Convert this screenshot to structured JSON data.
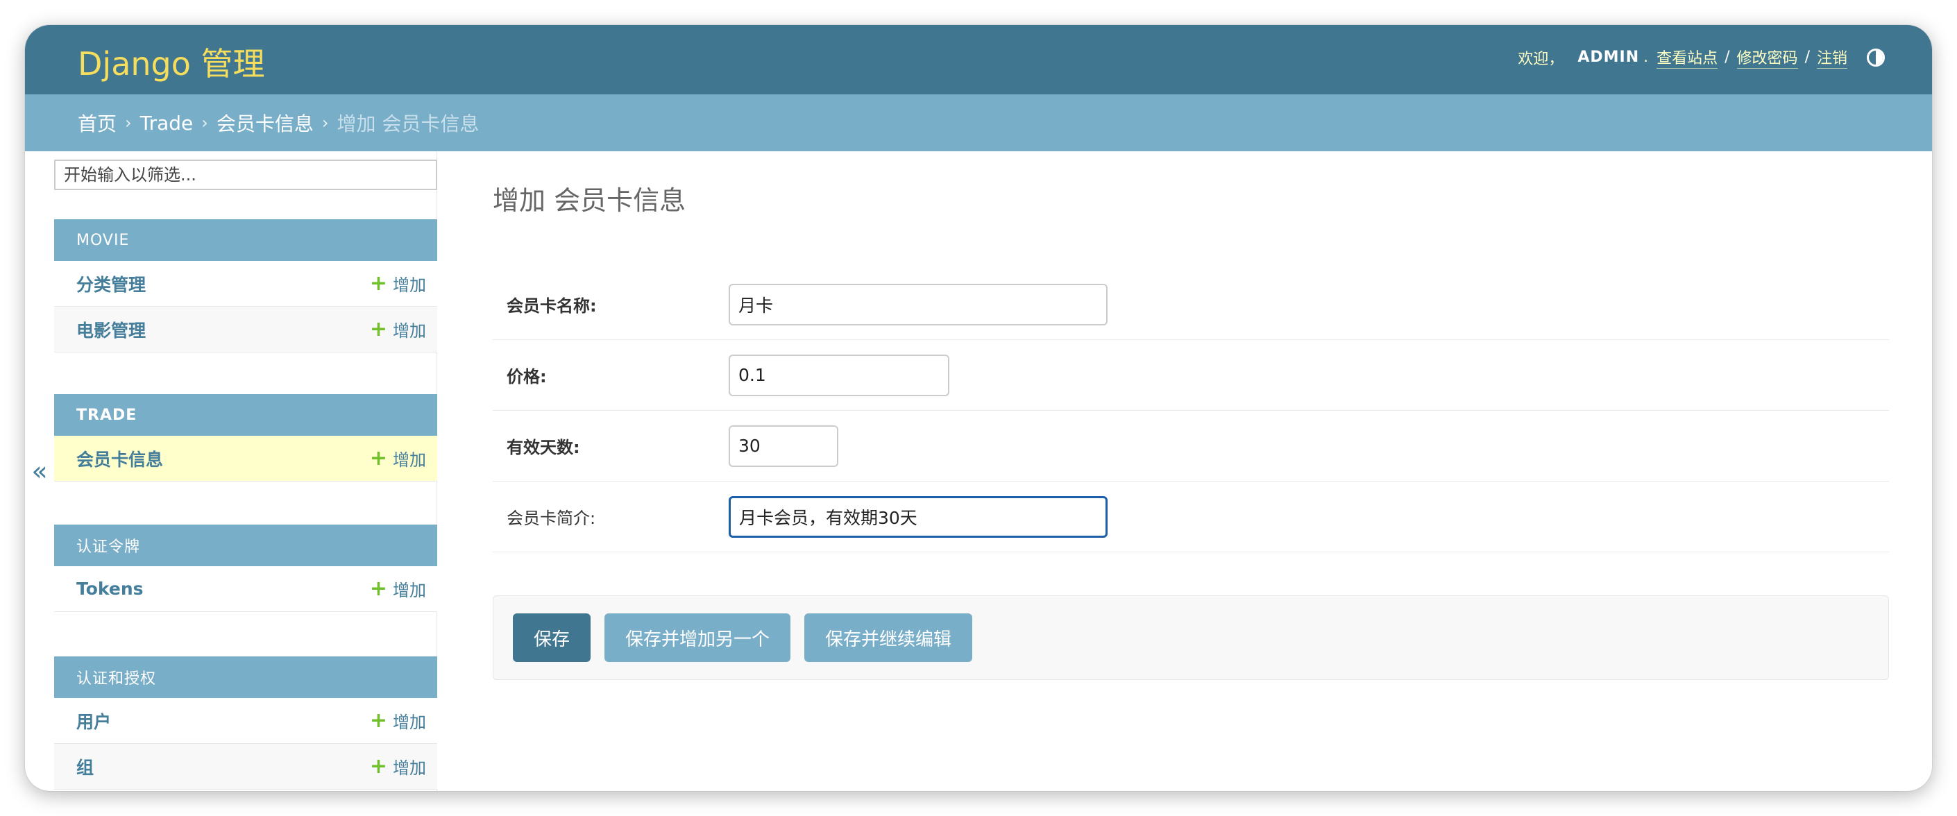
{
  "header": {
    "brand": "Django 管理",
    "welcome": "欢迎，",
    "username": "ADMIN",
    "view_site": "查看站点",
    "change_password": "修改密码",
    "logout": "注销",
    "sep": "/",
    "dot": "."
  },
  "breadcrumbs": {
    "home": "首页",
    "app": "Trade",
    "model": "会员卡信息",
    "current": "增加 会员卡信息",
    "arrow": "›"
  },
  "sidebar": {
    "filter_placeholder": "开始输入以筛选...",
    "collapse": "«",
    "add_label": "增加",
    "modules": [
      {
        "caption": "MOVIE",
        "items": [
          "分类管理",
          "电影管理"
        ]
      },
      {
        "caption": "TRADE",
        "items": [
          "会员卡信息"
        ]
      },
      {
        "caption": "认证令牌",
        "items": [
          "Tokens"
        ]
      },
      {
        "caption": "认证和授权",
        "items": [
          "用户",
          "组"
        ]
      }
    ]
  },
  "content": {
    "title": "增加 会员卡信息",
    "fields": [
      {
        "label": "会员卡名称:",
        "value": "月卡",
        "required": true
      },
      {
        "label": "价格:",
        "value": "0.1",
        "required": true
      },
      {
        "label": "有效天数:",
        "value": "30",
        "required": true
      },
      {
        "label": "会员卡简介:",
        "value": "月卡会员，有效期30天",
        "required": false
      }
    ],
    "buttons": {
      "save": "保存",
      "save_add_another": "保存并增加另一个",
      "save_continue": "保存并继续编辑"
    }
  },
  "colors": {
    "header_bg": "#417690",
    "breadcrumb_bg": "#79aec8",
    "brand": "#f5dd5d",
    "link": "#447e9b",
    "add_plus": "#70bf2b",
    "current_row": "#ffffcc"
  }
}
